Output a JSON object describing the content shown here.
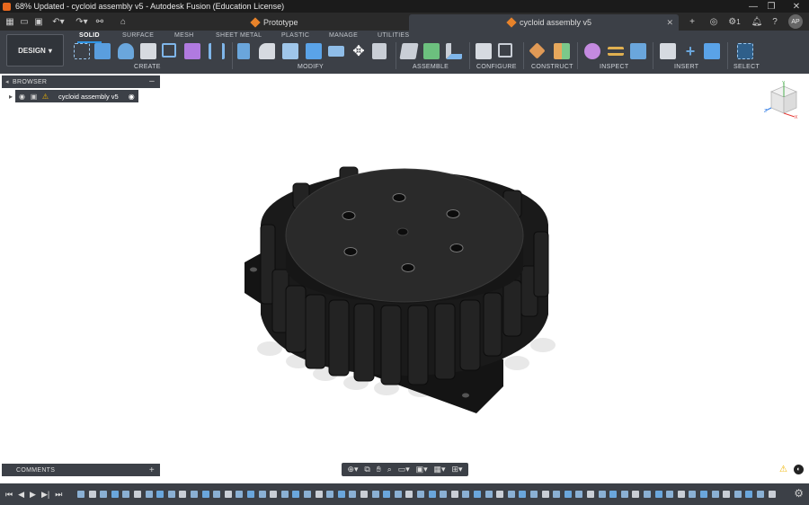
{
  "titlebar": {
    "title": "68% Updated - cycloid assembly v5 - Autodesk Fusion (Education License)",
    "minimize": "—",
    "restore": "❐",
    "close": "✕"
  },
  "tabs": {
    "left_tab": "Prototype",
    "active_tab": "cycloid assembly v5",
    "new_tab": "+",
    "job_status_count": "1",
    "avatar": "AP"
  },
  "ribbon": {
    "workspace": "DESIGN",
    "tabs": [
      "SOLID",
      "SURFACE",
      "MESH",
      "SHEET METAL",
      "PLASTIC",
      "MANAGE",
      "UTILITIES"
    ],
    "groups": [
      "CREATE",
      "MODIFY",
      "ASSEMBLE",
      "CONFIGURE",
      "CONSTRUCT",
      "INSPECT",
      "INSERT",
      "SELECT"
    ]
  },
  "browser": {
    "header": "BROWSER",
    "root": "cycloid assembly v5"
  },
  "comments": {
    "header": "COMMENTS"
  },
  "viewcube": {
    "x": "X",
    "y": "Y",
    "z": "Z"
  },
  "colors": {
    "ribbon_bg": "#3c4047",
    "accent": "#2f95e5",
    "part_body": "#1f1f1f"
  }
}
